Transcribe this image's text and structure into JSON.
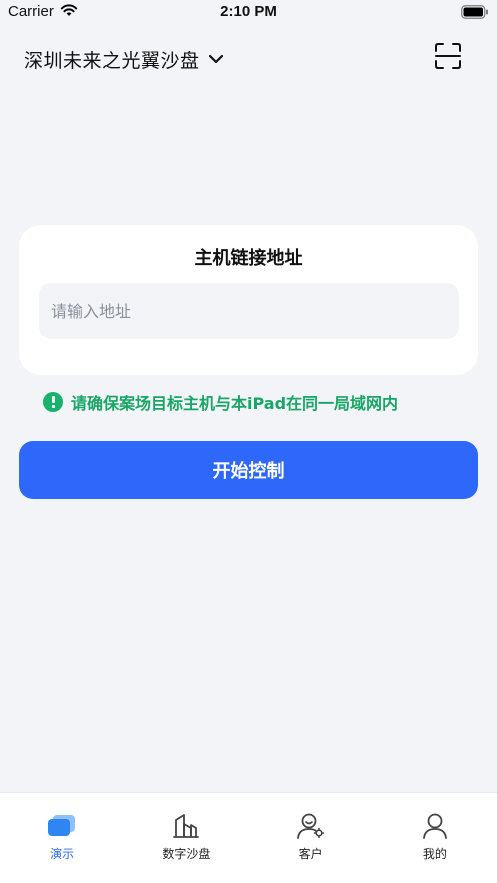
{
  "status_bar": {
    "carrier": "Carrier",
    "time": "2:10 PM"
  },
  "header": {
    "title": "深圳未来之光翼沙盘",
    "dropdown_icon": "chevron-down-icon",
    "scan_icon": "scan-icon"
  },
  "card": {
    "title": "主机链接地址",
    "address_placeholder": "请输入地址",
    "address_value": ""
  },
  "notice": {
    "icon": "exclamation-circle-icon",
    "text": "请确保案场目标主机与本iPad在同一局域网内",
    "color": "#19a566"
  },
  "actions": {
    "start_label": "开始控制",
    "accent_color": "#2d68fb"
  },
  "tab_bar": {
    "items": [
      {
        "label": "演示",
        "icon": "slides-icon",
        "active": true
      },
      {
        "label": "数字沙盘",
        "icon": "building-icon",
        "active": false
      },
      {
        "label": "客户",
        "icon": "customer-icon",
        "active": false
      },
      {
        "label": "我的",
        "icon": "profile-icon",
        "active": false
      }
    ]
  }
}
